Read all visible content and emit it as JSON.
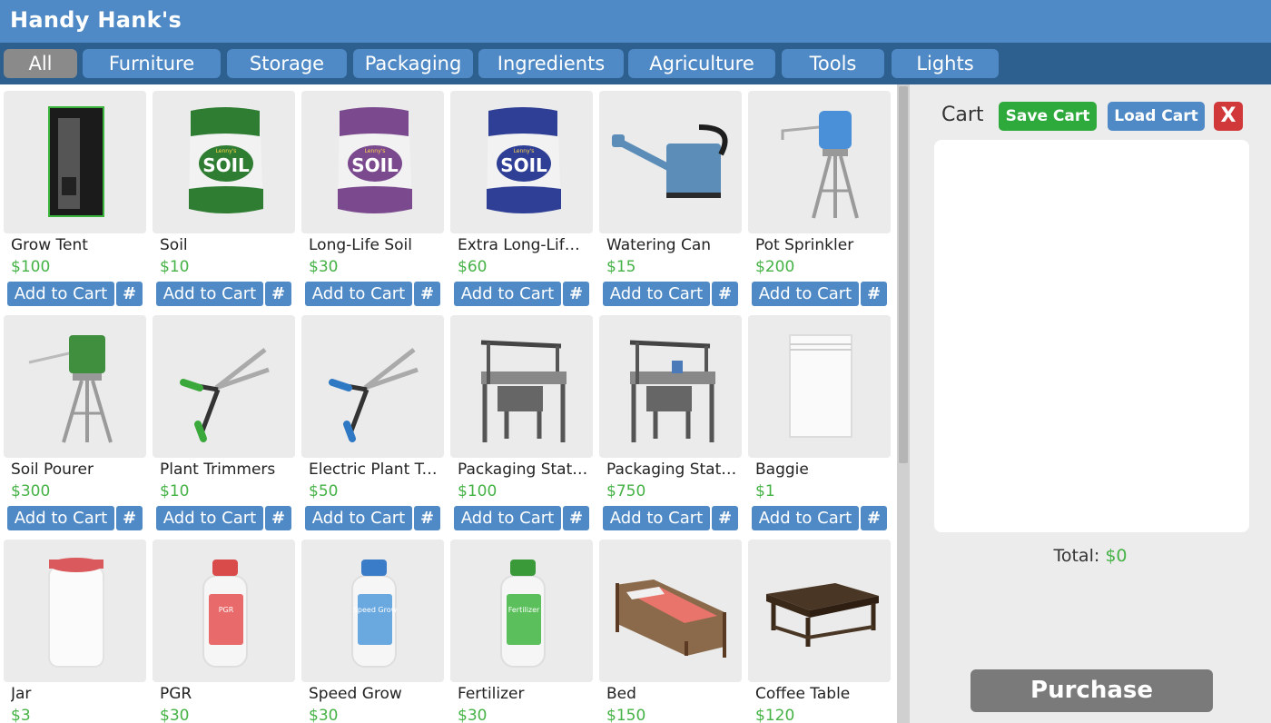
{
  "header": {
    "title": "Handy Hank's"
  },
  "tabs": [
    {
      "label": "All",
      "active": true
    },
    {
      "label": "Furniture"
    },
    {
      "label": "Storage"
    },
    {
      "label": "Packaging"
    },
    {
      "label": "Ingredients"
    },
    {
      "label": "Agriculture"
    },
    {
      "label": "Tools"
    },
    {
      "label": "Lights"
    }
  ],
  "products": [
    {
      "name": "Grow Tent",
      "price": "$100",
      "add_label": "Add to Cart",
      "qty_label": "#",
      "icon": "grow-tent-icon"
    },
    {
      "name": "Soil",
      "price": "$10",
      "add_label": "Add to Cart",
      "qty_label": "#",
      "icon": "soil-bag-icon",
      "color": "#2e7d32",
      "bag_text": "SOIL",
      "brand": "Lenny's"
    },
    {
      "name": "Long-Life Soil",
      "price": "$30",
      "add_label": "Add to Cart",
      "qty_label": "#",
      "icon": "long-life-soil-bag-icon",
      "color": "#7b4a8e",
      "bag_text": "SOIL",
      "brand": "Lenny's"
    },
    {
      "name": "Extra Long-Life Soil",
      "price": "$60",
      "add_label": "Add to Cart",
      "qty_label": "#",
      "icon": "extra-long-life-soil-bag-icon",
      "color": "#2e3f95",
      "bag_text": "SOIL",
      "brand": "Lenny's"
    },
    {
      "name": "Watering Can",
      "price": "$15",
      "add_label": "Add to Cart",
      "qty_label": "#",
      "icon": "watering-can-icon"
    },
    {
      "name": "Pot Sprinkler",
      "price": "$200",
      "add_label": "Add to Cart",
      "qty_label": "#",
      "icon": "pot-sprinkler-icon"
    },
    {
      "name": "Soil Pourer",
      "price": "$300",
      "add_label": "Add to Cart",
      "qty_label": "#",
      "icon": "soil-pourer-icon"
    },
    {
      "name": "Plant Trimmers",
      "price": "$10",
      "add_label": "Add to Cart",
      "qty_label": "#",
      "icon": "plant-trimmers-icon",
      "color": "#3aa83a"
    },
    {
      "name": "Electric Plant Trimmers",
      "price": "$50",
      "add_label": "Add to Cart",
      "qty_label": "#",
      "icon": "electric-plant-trimmers-icon",
      "color": "#2f78c4"
    },
    {
      "name": "Packaging Station",
      "price": "$100",
      "add_label": "Add to Cart",
      "qty_label": "#",
      "icon": "packaging-station-icon"
    },
    {
      "name": "Packaging Station Mk II",
      "price": "$750",
      "add_label": "Add to Cart",
      "qty_label": "#",
      "icon": "packaging-station-mk2-icon"
    },
    {
      "name": "Baggie",
      "price": "$1",
      "add_label": "Add to Cart",
      "qty_label": "#",
      "icon": "baggie-icon"
    },
    {
      "name": "Jar",
      "price": "$3",
      "add_label": "Add to Cart",
      "qty_label": "#",
      "icon": "jar-icon"
    },
    {
      "name": "PGR",
      "price": "$30",
      "add_label": "Add to Cart",
      "qty_label": "#",
      "icon": "pgr-bottle-icon",
      "color": "#e86a6a",
      "cap": "#d94a4a",
      "bottle_text": "PGR"
    },
    {
      "name": "Speed Grow",
      "price": "$30",
      "add_label": "Add to Cart",
      "qty_label": "#",
      "icon": "speed-grow-bottle-icon",
      "color": "#6aa8e0",
      "cap": "#3a7cc8",
      "bottle_text": "Speed Grow"
    },
    {
      "name": "Fertilizer",
      "price": "$30",
      "add_label": "Add to Cart",
      "qty_label": "#",
      "icon": "fertilizer-bottle-icon",
      "color": "#5bbf5b",
      "cap": "#3a9a3a",
      "bottle_text": "Fertilizer"
    },
    {
      "name": "Bed",
      "price": "$150",
      "add_label": "Add to Cart",
      "qty_label": "#",
      "icon": "bed-icon"
    },
    {
      "name": "Coffee Table",
      "price": "$120",
      "add_label": "Add to Cart",
      "qty_label": "#",
      "icon": "coffee-table-icon"
    }
  ],
  "cart": {
    "label": "Cart",
    "save_label": "Save Cart",
    "load_label": "Load Cart",
    "close_label": "X",
    "total_label": "Total: ",
    "total_value": "$0",
    "purchase_label": "Purchase",
    "items": []
  },
  "colors": {
    "header": "#4f8ac6",
    "tabbar": "#2d5f8f",
    "price": "#45b245",
    "save": "#2eaa3c",
    "close": "#d0383a"
  }
}
